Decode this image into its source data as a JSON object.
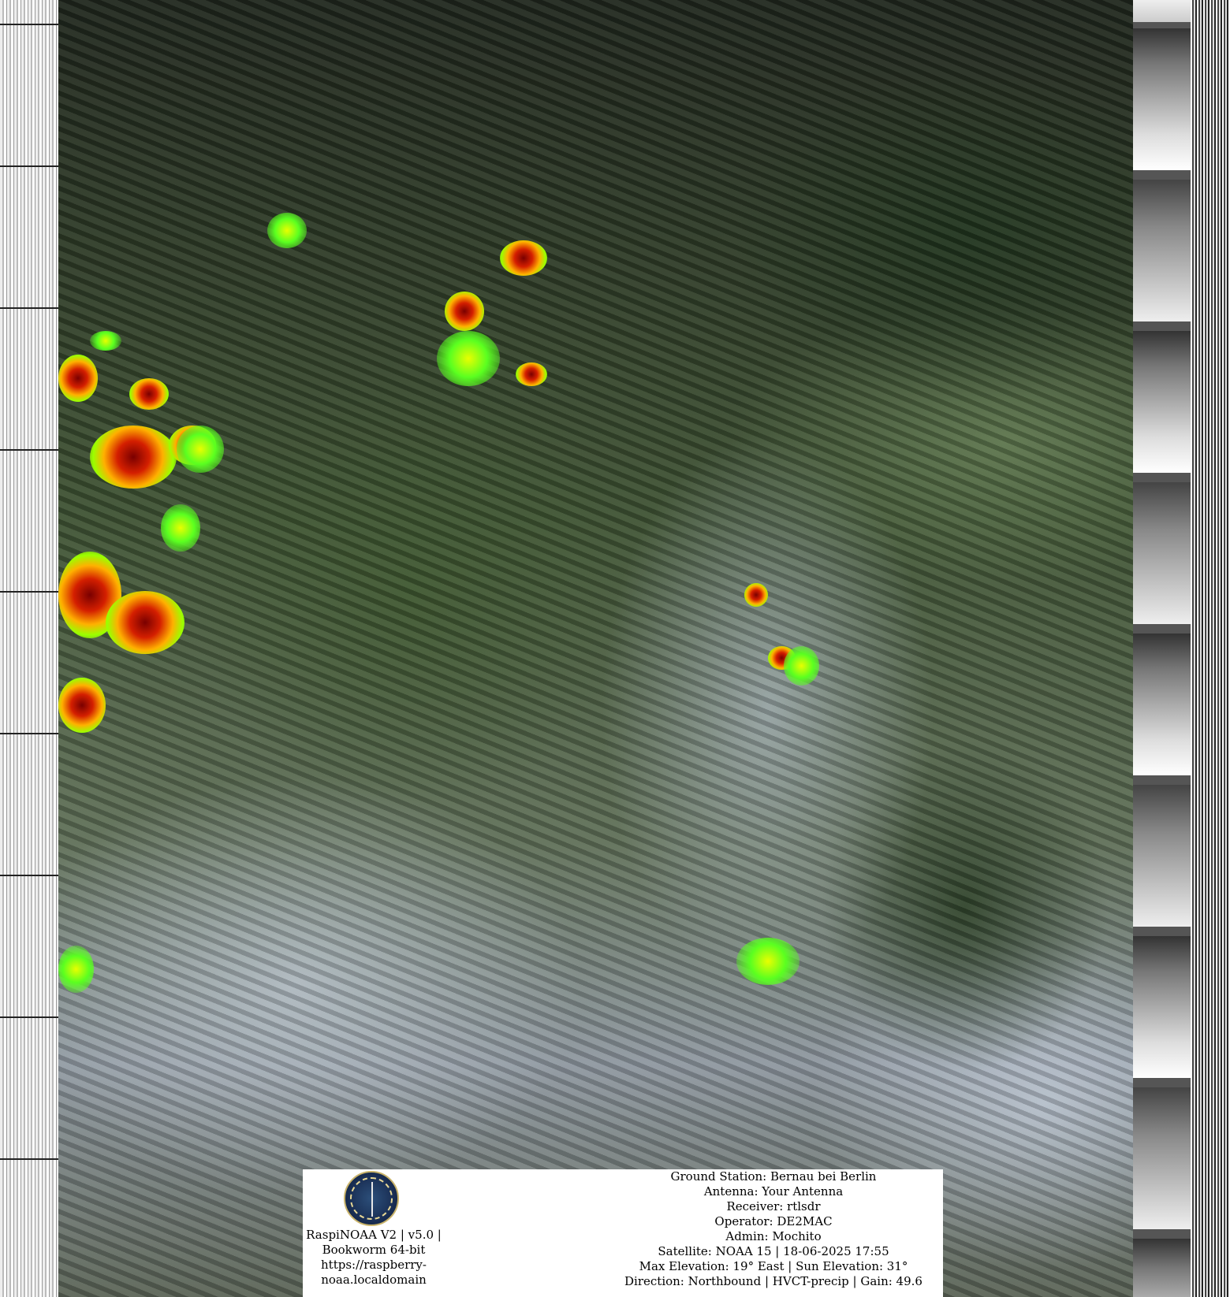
{
  "overlay": {
    "app": {
      "line1": "RaspiNOAA V2 | v5.0 |",
      "line2": "Bookworm 64-bit",
      "line3": "https://raspberry-",
      "line4": "noaa.localdomain"
    },
    "station": {
      "ground_station": "Ground Station: Bernau bei Berlin",
      "antenna": "Antenna: Your Antenna",
      "receiver": "Receiver: rtlsdr",
      "operator": "Operator: DE2MAC",
      "admin": "Admin: Mochito",
      "satellite": "Satellite: NOAA 15 | 18-06-2025 17:55",
      "elevation": "Max Elevation: 19° East | Sun Elevation: 31°",
      "direction": "Direction: Northbound | HVCT-precip | Gain: 49.6"
    }
  },
  "colors": {
    "precip_heavy": "#d41f00",
    "precip_medium": "#ffb000",
    "precip_light": "#5aff20",
    "background_box": "#ffffff"
  },
  "icons": {
    "logo": "raspi-noaa-station-logo"
  }
}
